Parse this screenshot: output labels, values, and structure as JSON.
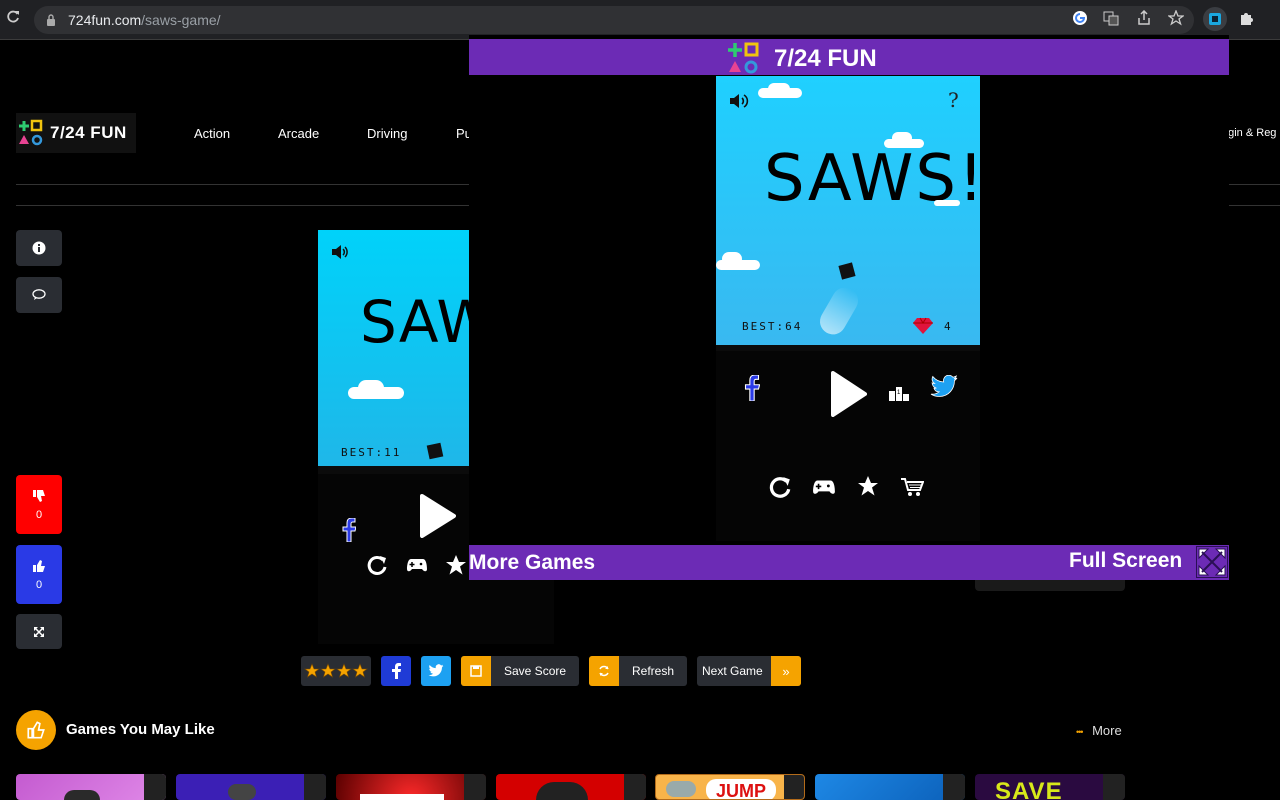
{
  "browser": {
    "url_host": "724fun.com",
    "url_path": "/saws-game/"
  },
  "site": {
    "logo_text": "7/24 FUN",
    "nav": [
      "Action",
      "Arcade",
      "Driving",
      "Pu"
    ],
    "login_text": "ogin & Reg"
  },
  "sidebar": {
    "dislike_count": "0",
    "like_count": "0"
  },
  "small_game": {
    "title": "SAWS",
    "best": "BEST:11"
  },
  "overlay": {
    "brand": "7/24 FUN",
    "game_title": "SAWS!",
    "best": "BEST:64",
    "gems": "4",
    "help": "?",
    "more_games": "More Games",
    "full_screen": "Full Screen"
  },
  "toolbar": {
    "save_score": "Save Score",
    "refresh": "Refresh",
    "next_game": "Next Game",
    "next_arrow": "»"
  },
  "section": {
    "title": "Games You May Like",
    "more": "More",
    "more_dots": "•••"
  },
  "thumbs": [
    "",
    "",
    "",
    "",
    "JUMP",
    "",
    "SAVE"
  ],
  "colors": {
    "purple": "#6c2bb5",
    "sky": "#1fd0ff",
    "orange": "#f5a300",
    "red": "#ff0000",
    "blue": "#2a3ae6",
    "twitter": "#1da1f2",
    "facebook": "#1f3bd6"
  }
}
